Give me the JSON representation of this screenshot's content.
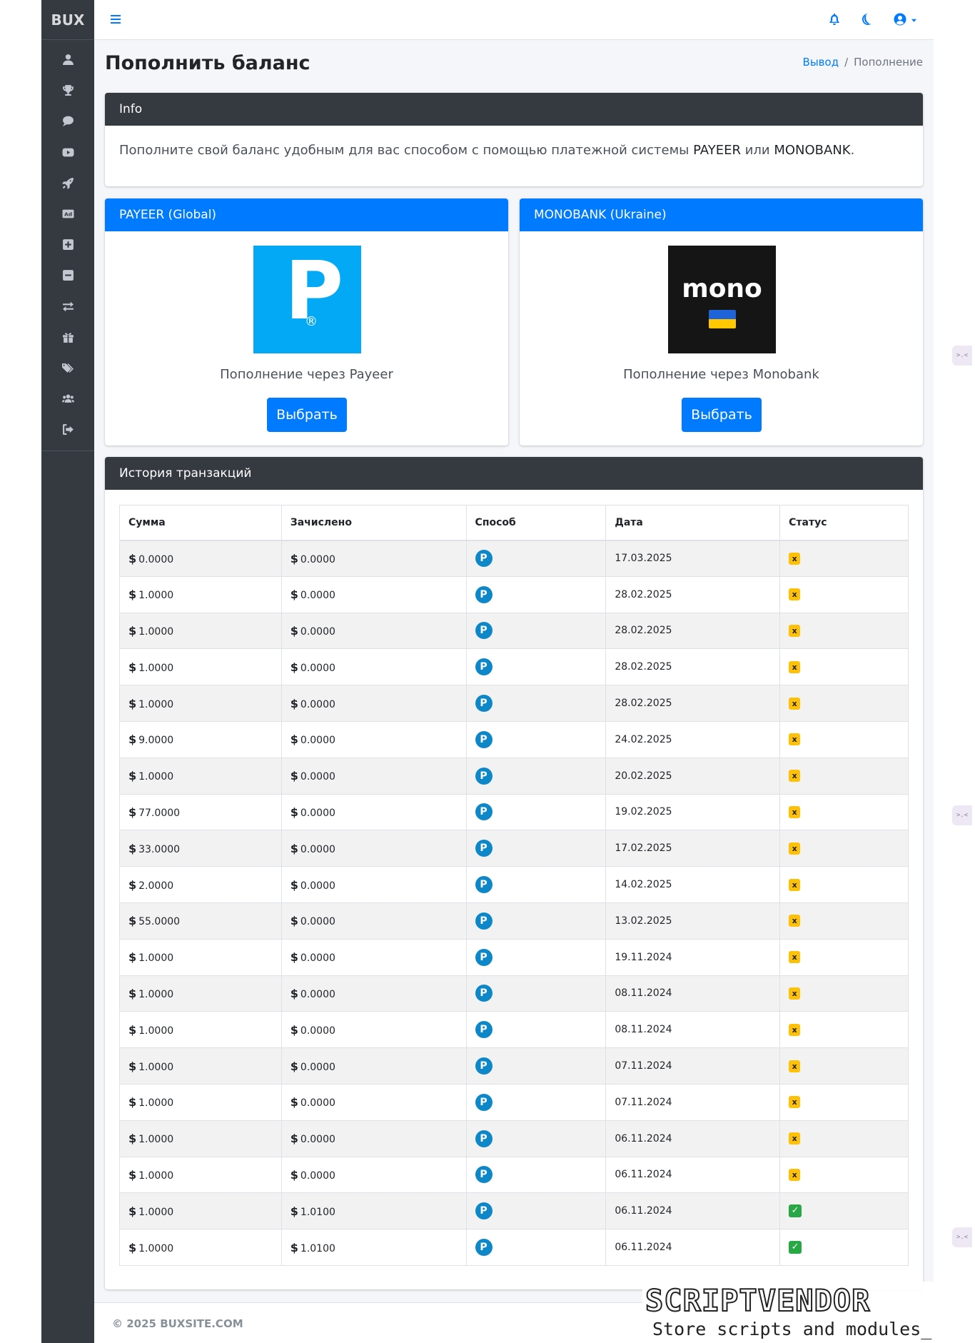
{
  "brand": "BUX",
  "sidebar": {
    "items": [
      {
        "icon": "user-icon"
      },
      {
        "icon": "trophy-icon"
      },
      {
        "icon": "comment-icon"
      },
      {
        "icon": "youtube-icon"
      },
      {
        "icon": "rocket-icon"
      },
      {
        "icon": "ad-icon"
      },
      {
        "icon": "plus-square-icon"
      },
      {
        "icon": "minus-square-icon"
      },
      {
        "icon": "exchange-icon"
      },
      {
        "icon": "gift-icon"
      },
      {
        "icon": "tags-icon"
      },
      {
        "icon": "users-icon"
      },
      {
        "icon": "sign-out-icon"
      }
    ]
  },
  "topbar": {
    "menu_icon": "hamburger-icon",
    "notification_icon": "bell-icon",
    "theme_icon": "moon-icon",
    "account_icon": "user-circle-icon",
    "accent_color": "#007bff"
  },
  "page": {
    "title": "Пополнить баланс",
    "breadcrumb": {
      "link": "Вывод",
      "separator": "/",
      "current": "Пополнение"
    }
  },
  "info": {
    "header": "Info",
    "text_before": "Пополните свой баланс удобным для вас способом с помощью платежной системы ",
    "payeer": "PAYEER",
    "text_middle": " или ",
    "monobank": "MONOBANK",
    "text_end": "."
  },
  "payeer_card": {
    "header": "PAYEER (Global)",
    "logo_letter": "P",
    "logo_mark": "®",
    "label": "Пополнение через Payeer",
    "button": "Выбрать",
    "logo_color": "#03a9f4"
  },
  "mono_card": {
    "header": "MONOBANK (Ukraine)",
    "logo_text": "mono",
    "label": "Пополнение через Monobank",
    "button": "Выбрать"
  },
  "history": {
    "header": "История транзакций",
    "columns": [
      "Сумма",
      "Зачислено",
      "Способ",
      "Дата",
      "Статус"
    ],
    "currency": "$",
    "method_letter": "P",
    "status_failed": "x",
    "status_success": "✓",
    "rows": [
      {
        "amount": "0.0000",
        "credited": "0.0000",
        "date": "17.03.2025",
        "status": "failed"
      },
      {
        "amount": "1.0000",
        "credited": "0.0000",
        "date": "28.02.2025",
        "status": "failed"
      },
      {
        "amount": "1.0000",
        "credited": "0.0000",
        "date": "28.02.2025",
        "status": "failed"
      },
      {
        "amount": "1.0000",
        "credited": "0.0000",
        "date": "28.02.2025",
        "status": "failed"
      },
      {
        "amount": "1.0000",
        "credited": "0.0000",
        "date": "28.02.2025",
        "status": "failed"
      },
      {
        "amount": "9.0000",
        "credited": "0.0000",
        "date": "24.02.2025",
        "status": "failed"
      },
      {
        "amount": "1.0000",
        "credited": "0.0000",
        "date": "20.02.2025",
        "status": "failed"
      },
      {
        "amount": "77.0000",
        "credited": "0.0000",
        "date": "19.02.2025",
        "status": "failed"
      },
      {
        "amount": "33.0000",
        "credited": "0.0000",
        "date": "17.02.2025",
        "status": "failed"
      },
      {
        "amount": "2.0000",
        "credited": "0.0000",
        "date": "14.02.2025",
        "status": "failed"
      },
      {
        "amount": "55.0000",
        "credited": "0.0000",
        "date": "13.02.2025",
        "status": "failed"
      },
      {
        "amount": "1.0000",
        "credited": "0.0000",
        "date": "19.11.2024",
        "status": "failed"
      },
      {
        "amount": "1.0000",
        "credited": "0.0000",
        "date": "08.11.2024",
        "status": "failed"
      },
      {
        "amount": "1.0000",
        "credited": "0.0000",
        "date": "08.11.2024",
        "status": "failed"
      },
      {
        "amount": "1.0000",
        "credited": "0.0000",
        "date": "07.11.2024",
        "status": "failed"
      },
      {
        "amount": "1.0000",
        "credited": "0.0000",
        "date": "07.11.2024",
        "status": "failed"
      },
      {
        "amount": "1.0000",
        "credited": "0.0000",
        "date": "06.11.2024",
        "status": "failed"
      },
      {
        "amount": "1.0000",
        "credited": "0.0000",
        "date": "06.11.2024",
        "status": "failed"
      },
      {
        "amount": "1.0000",
        "credited": "1.0100",
        "date": "06.11.2024",
        "status": "success"
      },
      {
        "amount": "1.0000",
        "credited": "1.0100",
        "date": "06.11.2024",
        "status": "success"
      }
    ]
  },
  "footer": {
    "copyright": "© 2025 BUXSITE.COM"
  },
  "watermark": {
    "title": "SCRIPTVENDOR",
    "subtitle": "Store scripts and modules_"
  },
  "side_widget": {
    "label": ">.<"
  }
}
